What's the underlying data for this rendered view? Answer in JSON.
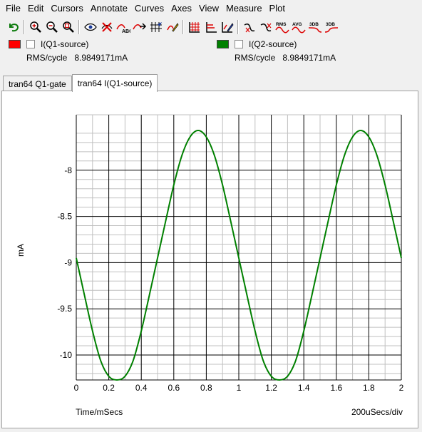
{
  "menu": [
    "File",
    "Edit",
    "Cursors",
    "Annotate",
    "Curves",
    "Axes",
    "View",
    "Measure",
    "Plot"
  ],
  "toolbar": {
    "labels": {
      "rms": "RMS",
      "avg": "AVG",
      "db1": "3DB",
      "db2": "3DB"
    }
  },
  "legend": [
    {
      "name": "I(Q1-source)",
      "color": "#ff0000",
      "checked": false,
      "rms_label": "RMS/cycle",
      "rms_value": "8.9849171mA"
    },
    {
      "name": "I(Q2-source)",
      "color": "#008000",
      "checked": false,
      "rms_label": "RMS/cycle",
      "rms_value": "8.9849171mA"
    }
  ],
  "tabs": [
    {
      "label": "tran64 Q1-gate",
      "active": false
    },
    {
      "label": "tran64 I(Q1-source)",
      "active": true
    }
  ],
  "plot": {
    "ylabel": "mA",
    "xlabel": "Time/mSecs",
    "xdiv": "200uSecs/div",
    "x_tick_labels": [
      "0",
      "0.2",
      "0.4",
      "0.6",
      "0.8",
      "1",
      "1.2",
      "1.4",
      "1.6",
      "1.8",
      "2"
    ],
    "y_tick_labels": [
      "-8",
      "-8.5",
      "-9",
      "-9.5",
      "-10"
    ]
  },
  "chart_data": {
    "type": "line",
    "xlabel": "Time/mSecs",
    "ylabel": "mA",
    "xlim": [
      0,
      2
    ],
    "ylim": [
      -10.27,
      -7.4
    ],
    "xticks": [
      0,
      0.2,
      0.4,
      0.6,
      0.8,
      1,
      1.2,
      1.4,
      1.6,
      1.8,
      2
    ],
    "yticks": [
      -8,
      -8.5,
      -9,
      -9.5,
      -10
    ],
    "grid": true,
    "series": [
      {
        "name": "I(Q2-source)",
        "color": "#008000",
        "x": [
          0,
          0.05,
          0.1,
          0.15,
          0.2,
          0.25,
          0.3,
          0.35,
          0.4,
          0.45,
          0.5,
          0.55,
          0.6,
          0.65,
          0.7,
          0.75,
          0.8,
          0.85,
          0.9,
          0.95,
          1.0,
          1.05,
          1.1,
          1.15,
          1.2,
          1.25,
          1.3,
          1.35,
          1.4,
          1.45,
          1.5,
          1.55,
          1.6,
          1.65,
          1.7,
          1.75,
          1.8,
          1.85,
          1.9,
          1.95,
          2.0
        ],
        "y": [
          -8.95,
          -9.35,
          -9.74,
          -10.06,
          -10.23,
          -10.27,
          -10.23,
          -10.06,
          -9.74,
          -9.35,
          -8.95,
          -8.55,
          -8.16,
          -7.84,
          -7.64,
          -7.57,
          -7.64,
          -7.84,
          -8.16,
          -8.55,
          -8.95,
          -9.35,
          -9.74,
          -10.06,
          -10.23,
          -10.27,
          -10.23,
          -10.06,
          -9.74,
          -9.35,
          -8.95,
          -8.55,
          -8.16,
          -7.84,
          -7.64,
          -7.57,
          -7.64,
          -7.84,
          -8.16,
          -8.55,
          -8.95
        ]
      }
    ]
  }
}
